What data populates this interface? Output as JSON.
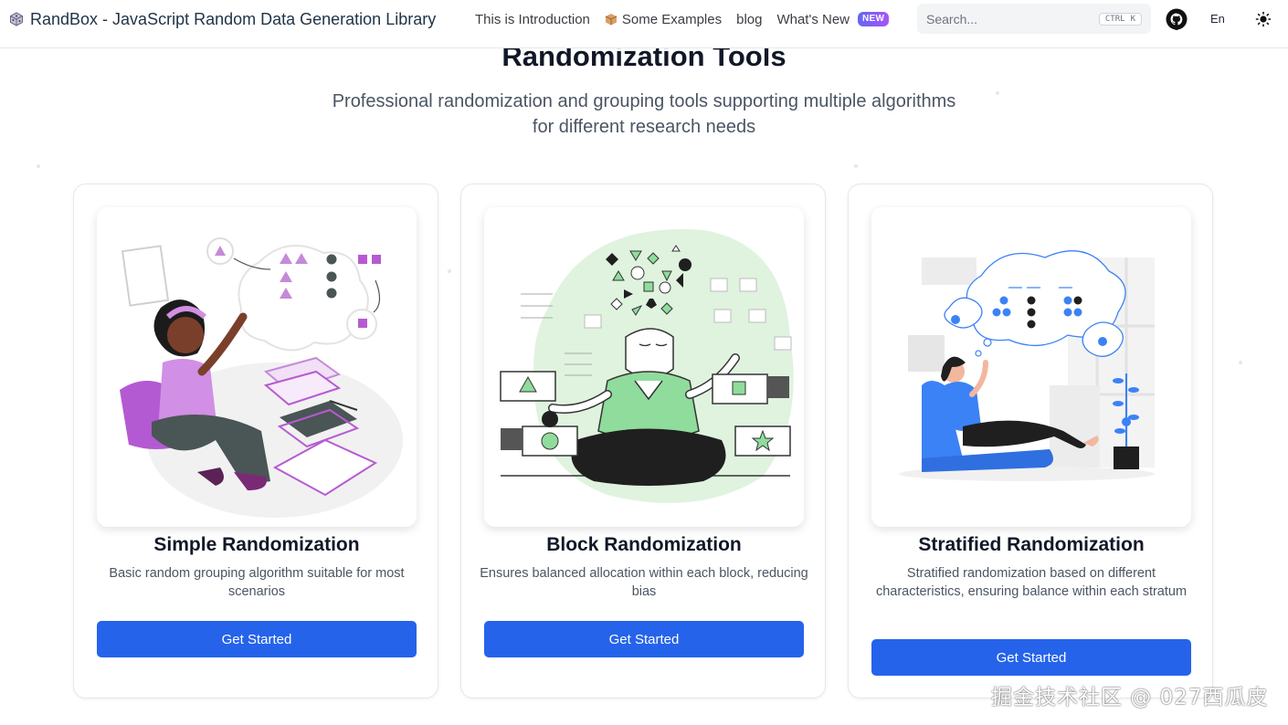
{
  "nav": {
    "brand": "RandBox - JavaScript Random Data Generation Library",
    "links": [
      "This is Introduction",
      "Some Examples",
      "blog",
      "What's New"
    ],
    "new_badge": "NEW",
    "search_placeholder": "Search...",
    "search_shortcut": [
      "CTRL",
      "K"
    ],
    "language": "En"
  },
  "hero": {
    "title": "Randomization Tools",
    "subtitle_line1": "Professional randomization and grouping tools supporting multiple algorithms",
    "subtitle_line2": "for different research needs"
  },
  "cards": [
    {
      "title": "Simple Randomization",
      "desc": "Basic random grouping algorithm suitable for most scenarios",
      "button": "Get Started"
    },
    {
      "title": "Block Randomization",
      "desc": "Ensures balanced allocation within each block, reducing bias",
      "button": "Get Started"
    },
    {
      "title": "Stratified Randomization",
      "desc": "Stratified randomization based on different characteristics, ensuring balance within each stratum",
      "button": "Get Started"
    }
  ],
  "watermark": "掘金技术社区 @ 027西瓜皮",
  "colors": {
    "primary": "#2563eb",
    "accent_purple": "#b36bd4",
    "accent_green": "#8fdc9c",
    "accent_blue": "#3b82f6"
  }
}
